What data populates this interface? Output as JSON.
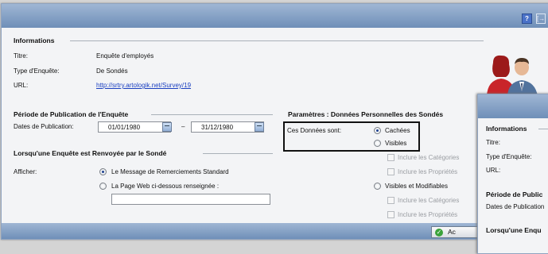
{
  "window": {
    "help_label": "?",
    "exit_label": "[→"
  },
  "informations": {
    "legend": "Informations",
    "titre_label": "Titre:",
    "titre_value": "Enquête d'employés",
    "type_label": "Type d'Enquête:",
    "type_value": "De Sondés",
    "url_label": "URL:",
    "url_value": "http://srtry.artologik.net/Survey/19"
  },
  "periode": {
    "legend": "Période de Publication de l'Enquête",
    "dates_label": "Dates de Publication:",
    "start_date": "01/01/1980",
    "separator": "–",
    "end_date": "31/12/1980"
  },
  "renvoyee": {
    "legend": "Lorsqu'une Enquête est Renvoyée par le Sondé",
    "afficher_label": "Afficher:",
    "option1": "Le Message de Remerciements Standard",
    "option2": "La Page Web ci-dessous renseignée :",
    "url_input_value": ""
  },
  "parametres": {
    "legend": "Paramètres : Données Personnelles des Sondés",
    "donnees_label": "Ces Données sont:",
    "cachees": "Cachées",
    "visibles": "Visibles",
    "inclure_categories": "Inclure les Catégories",
    "inclure_proprietes": "Inclure les Propriétés",
    "visibles_modifiables": "Visibles et Modifiables",
    "inclure_categories_2": "Inclure les Catégories",
    "inclure_proprietes_2": "Inclure les Propriétés"
  },
  "footer": {
    "ok_button": "Ac"
  },
  "second_window": {
    "informations": "Informations",
    "titre": "Titre:",
    "type": "Type d'Enquête:",
    "url": "URL:",
    "periode": "Période de Public",
    "dates": "Dates de Publication",
    "lorsque": "Lorsqu'une Enqu"
  },
  "colors": {
    "titlebar": "#7f9cc4",
    "link": "#1a3fc0",
    "radio_on": "#1b3f8f"
  }
}
